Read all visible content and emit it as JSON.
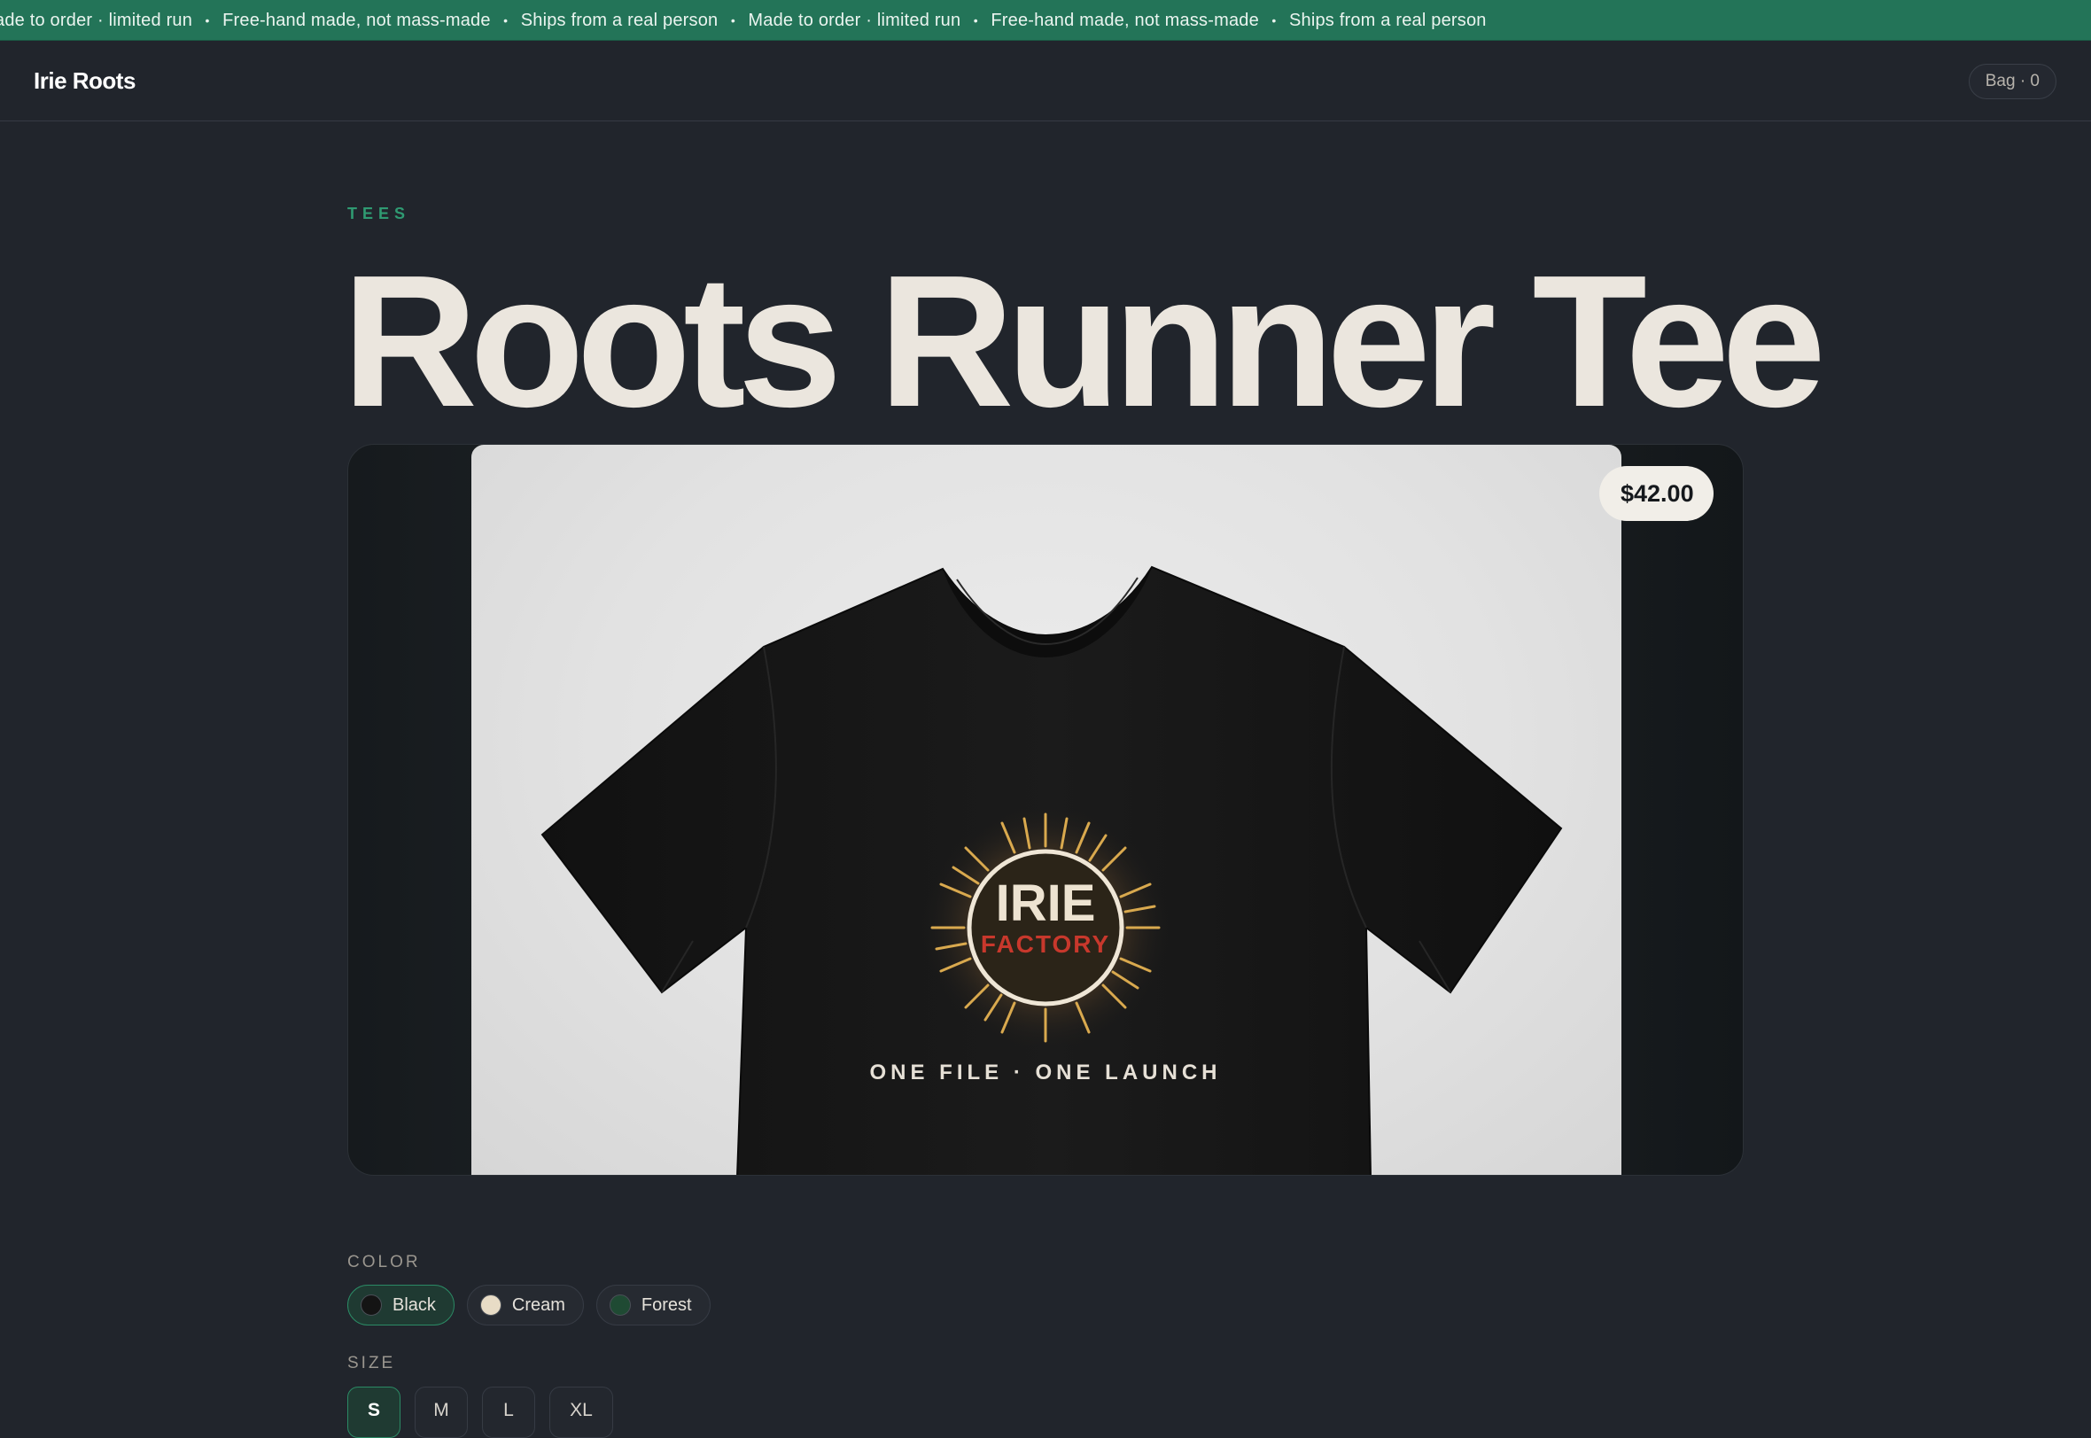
{
  "ticker": {
    "items": [
      "ade to order · limited run",
      "Free-hand made, not mass-made",
      "Ships from a real person",
      "Made to order · limited run",
      "Free-hand made, not mass-made",
      "Ships from a real person"
    ],
    "separator": "•",
    "background": "#237458"
  },
  "header": {
    "brand": "Irie Roots",
    "bag_label": "Bag · 0"
  },
  "product": {
    "category": "TEES",
    "title": "Roots Runner Tee",
    "price": "$42.00",
    "graphic": {
      "line1": "IRIE",
      "line2": "FACTORY",
      "tagline": "ONE FILE · ONE LAUNCH"
    }
  },
  "options": {
    "color_label": "COLOR",
    "colors": [
      {
        "label": "Black",
        "swatch": "#141414",
        "selected": true
      },
      {
        "label": "Cream",
        "swatch": "#e8dcc6",
        "selected": false
      },
      {
        "label": "Forest",
        "swatch": "#1f4a33",
        "selected": false
      }
    ],
    "size_label": "SIZE",
    "sizes": [
      {
        "label": "S",
        "selected": true
      },
      {
        "label": "M",
        "selected": false
      },
      {
        "label": "L",
        "selected": false
      },
      {
        "label": "XL",
        "selected": false
      }
    ]
  },
  "accent_color": "#2f9a72"
}
